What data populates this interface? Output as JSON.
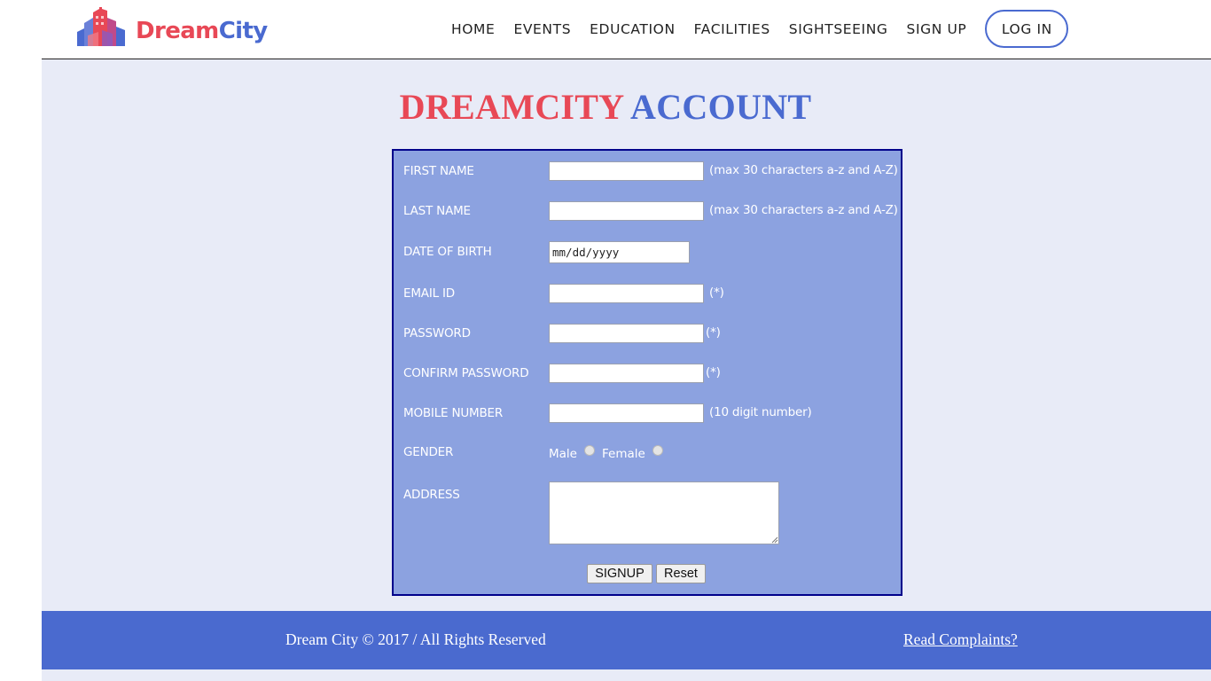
{
  "header": {
    "logo": {
      "part1": "Dream",
      "part2": "City"
    },
    "nav": [
      "HOME",
      "EVENTS",
      "EDUCATION",
      "FACILITIES",
      "SIGHTSEEING",
      "SIGN UP"
    ],
    "login_label": "LOG IN"
  },
  "main": {
    "title_part1": "DREAMCITY",
    "title_part2": "ACCOUNT"
  },
  "form": {
    "fields": {
      "first_name": {
        "label": "FIRST NAME",
        "value": "",
        "hint": "(max 30 characters a-z and A-Z)"
      },
      "last_name": {
        "label": "LAST NAME",
        "value": "",
        "hint": "(max 30 characters a-z and A-Z)"
      },
      "dob": {
        "label": "DATE OF BIRTH",
        "value": "mm/dd/yyyy"
      },
      "email": {
        "label": "EMAIL ID",
        "value": "",
        "hint": "(*)"
      },
      "password": {
        "label": "PASSWORD",
        "value": "",
        "hint": "(*)"
      },
      "confirm_password": {
        "label": "CONFIRM PASSWORD",
        "value": "",
        "hint": "(*)"
      },
      "mobile": {
        "label": "MOBILE NUMBER",
        "value": "",
        "hint": "(10 digit number)"
      },
      "gender": {
        "label": "GENDER",
        "options": [
          "Male",
          "Female"
        ],
        "selected": ""
      },
      "address": {
        "label": "ADDRESS",
        "value": ""
      }
    },
    "buttons": {
      "signup": "SIGNUP",
      "reset": "Reset"
    }
  },
  "footer": {
    "copyright": "Dream City © 2017 / All Rights Reserved",
    "complaints_link": "Read Complaints?"
  },
  "colors": {
    "brand_red": "#e84856",
    "brand_blue": "#4a6ad0",
    "form_bg": "#8ca2e0",
    "form_border": "#00008b",
    "page_bg": "#e8ebf7",
    "footer_bg": "#4a6acf"
  }
}
